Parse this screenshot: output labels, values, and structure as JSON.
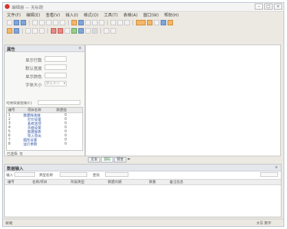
{
  "window": {
    "title": "编辑器 — 无标题",
    "controls": [
      "–",
      "□",
      "×"
    ]
  },
  "menu": [
    "文件(F)",
    "编辑(E)",
    "查看(V)",
    "插入(I)",
    "格式(O)",
    "工具(T)",
    "表格(A)",
    "窗口(W)",
    "帮助(H)"
  ],
  "left_panel": {
    "title": "属性",
    "close": "✕",
    "fields": [
      {
        "label": "显示行数",
        "value": ""
      },
      {
        "label": "默认宽度",
        "value": ""
      },
      {
        "label": "显示颜色",
        "value": ""
      },
      {
        "label": "字体大小",
        "value": "默认大小"
      }
    ],
    "filter_label": "可用快速连接(C)",
    "list_headers": [
      "编号",
      "项目名称",
      "数据值"
    ],
    "list_rows": [
      {
        "id": "1",
        "name": "数据库连接",
        "val": "0"
      },
      {
        "id": "2",
        "name": "打印设置",
        "val": "0"
      },
      {
        "id": "3",
        "name": "系统选项",
        "val": "0"
      },
      {
        "id": "4",
        "name": "页面设置",
        "val": "0"
      },
      {
        "id": "5",
        "name": "数据报表",
        "val": "0"
      },
      {
        "id": "6",
        "name": "导入导出",
        "val": "0"
      },
      {
        "id": "7",
        "name": "图形设置",
        "val": "0"
      },
      {
        "id": "8",
        "name": "运行参数",
        "val": "0"
      }
    ],
    "status": "已选择: 无"
  },
  "editor": {
    "tabs": [
      "文本",
      "源码",
      "预览"
    ],
    "nav": "◂▸"
  },
  "bottom_panel": {
    "title": "数据输入",
    "close": "✕",
    "filters": [
      {
        "label": "输入",
        "value": ""
      },
      {
        "label": "类型名称",
        "value": ""
      },
      {
        "label": "查找",
        "value": ""
      }
    ],
    "right_value": "",
    "columns": [
      "编号",
      "名称/项目",
      "所属类型",
      "数据日期",
      "数量",
      "备注信息"
    ]
  },
  "status": {
    "left": "就绪",
    "right": "大写  数字"
  },
  "colors": {
    "accent": "#2f55a4",
    "tab_active_text": "#2d7d2d",
    "window_bg": "#ece9e2"
  }
}
